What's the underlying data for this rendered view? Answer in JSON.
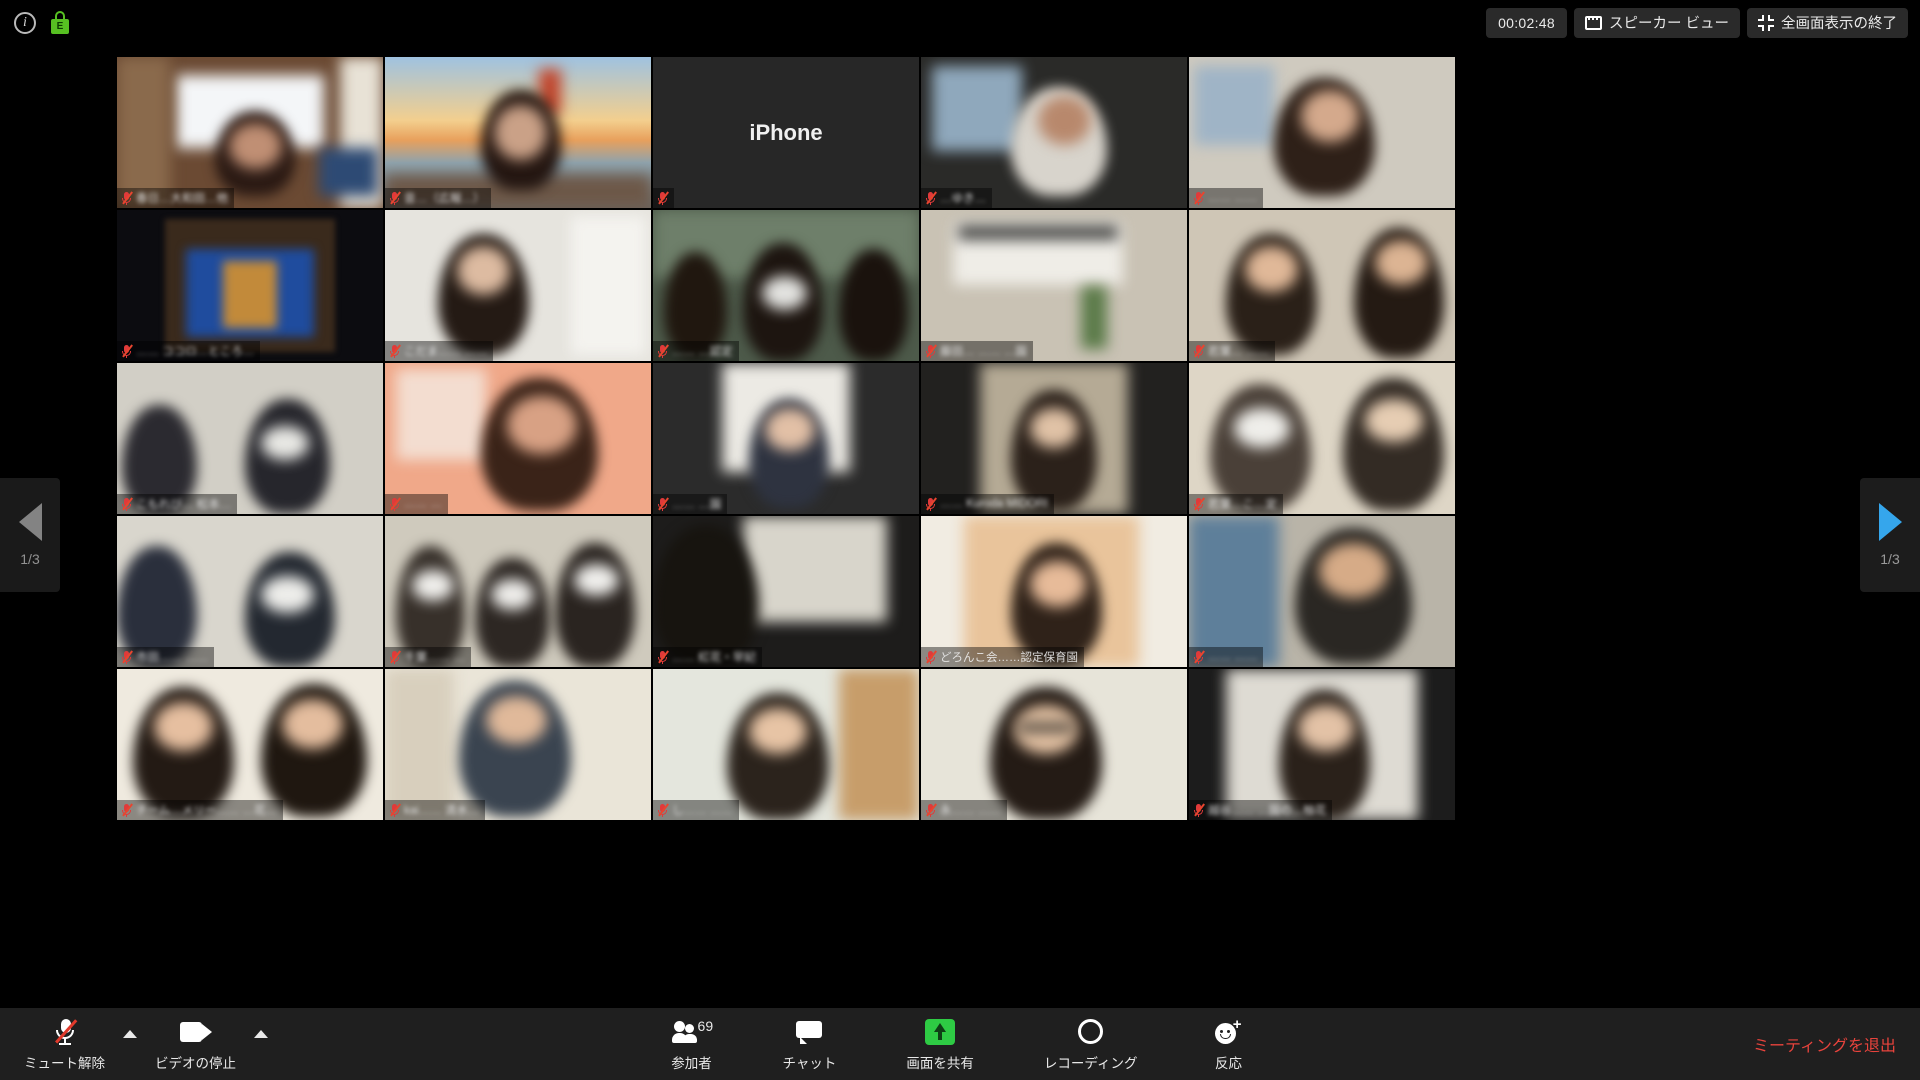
{
  "topbar": {
    "info_icon": "info-icon",
    "encryption_icon": "lock-icon",
    "encryption_letter": "E",
    "timer": "00:02:48",
    "speaker_view_label": "スピーカー ビュー",
    "exit_fullscreen_label": "全画面表示の終了"
  },
  "pagination": {
    "prev_label": "1/3",
    "next_label": "1/3",
    "prev_enabled": false,
    "next_enabled": true
  },
  "gallery": {
    "columns": 5,
    "rows": 5,
    "active_speaker_color": "#d9ec63",
    "tiles": [
      {
        "name": "春日…大和田…他",
        "muted": true,
        "blurred_name": true,
        "active": true,
        "kind": "video",
        "bg": "room-window",
        "placeholder": ""
      },
      {
        "name": "音…（広報…）",
        "muted": true,
        "blurred_name": true,
        "active": false,
        "kind": "video",
        "bg": "golden-gate",
        "placeholder": ""
      },
      {
        "name": "",
        "muted": true,
        "blurred_name": false,
        "active": false,
        "kind": "novideo",
        "bg": "dark",
        "placeholder": "iPhone"
      },
      {
        "name": "…ゆき…",
        "muted": true,
        "blurred_name": true,
        "active": false,
        "kind": "video",
        "bg": "room-dark",
        "placeholder": ""
      },
      {
        "name": "…… ……",
        "muted": true,
        "blurred_name": true,
        "active": false,
        "kind": "video",
        "bg": "room-blinds",
        "placeholder": ""
      },
      {
        "name": "…… ココロ…ところ…",
        "muted": true,
        "blurred_name": true,
        "active": false,
        "kind": "video",
        "bg": "notre-dame",
        "placeholder": ""
      },
      {
        "name": "こだま…… ……",
        "muted": true,
        "blurred_name": true,
        "active": false,
        "kind": "video",
        "bg": "room-white",
        "placeholder": ""
      },
      {
        "name": "…… …認定",
        "muted": true,
        "blurred_name": true,
        "active": false,
        "kind": "video",
        "bg": "room-group3",
        "placeholder": ""
      },
      {
        "name": "藤田… …… …園",
        "muted": true,
        "blurred_name": true,
        "active": false,
        "kind": "video",
        "bg": "room-shelf",
        "placeholder": ""
      },
      {
        "name": "若葉… ……",
        "muted": true,
        "blurred_name": true,
        "active": false,
        "kind": "video",
        "bg": "room-pair",
        "placeholder": ""
      },
      {
        "name": "こもれび… 松本…",
        "muted": true,
        "blurred_name": true,
        "active": false,
        "kind": "video",
        "bg": "room-gray-pair",
        "placeholder": ""
      },
      {
        "name": "…… …",
        "muted": true,
        "blurred_name": true,
        "active": false,
        "kind": "video",
        "bg": "room-warm",
        "placeholder": ""
      },
      {
        "name": "…… …園",
        "muted": true,
        "blurred_name": true,
        "active": false,
        "kind": "video",
        "bg": "room-stripe",
        "placeholder": ""
      },
      {
        "name": "…… Kuroda MIDORI",
        "muted": true,
        "blurred_name": true,
        "active": false,
        "kind": "video",
        "bg": "room-dim",
        "placeholder": ""
      },
      {
        "name": "若葉…こ…定",
        "muted": true,
        "blurred_name": true,
        "active": false,
        "kind": "video",
        "bg": "room-mask-pair",
        "placeholder": ""
      },
      {
        "name": "市田…… ……",
        "muted": true,
        "blurred_name": true,
        "active": false,
        "kind": "video",
        "bg": "room-dark-navy",
        "placeholder": ""
      },
      {
        "name": "千葉…… …",
        "muted": true,
        "blurred_name": true,
        "active": false,
        "kind": "video",
        "bg": "room-masks3",
        "placeholder": ""
      },
      {
        "name": "…… 紅花・早妃",
        "muted": true,
        "blurred_name": true,
        "active": false,
        "kind": "video",
        "bg": "room-dark-person",
        "placeholder": ""
      },
      {
        "name": "どろんこ会……認定保育園",
        "muted": true,
        "blurred_name": false,
        "active": false,
        "kind": "video",
        "bg": "room-beige",
        "placeholder": ""
      },
      {
        "name": "…… ……",
        "muted": true,
        "blurred_name": true,
        "active": false,
        "kind": "video",
        "bg": "room-office-man",
        "placeholder": ""
      },
      {
        "name": "チーム…メリー…… …花…",
        "muted": true,
        "blurred_name": true,
        "active": false,
        "kind": "video",
        "bg": "room-two-women",
        "placeholder": ""
      },
      {
        "name": "kai…… 清水…",
        "muted": true,
        "blurred_name": true,
        "active": false,
        "kind": "video",
        "bg": "room-denim",
        "placeholder": ""
      },
      {
        "name": "し…… ……",
        "muted": true,
        "blurred_name": true,
        "active": false,
        "kind": "video",
        "bg": "room-wood",
        "placeholder": ""
      },
      {
        "name": "永…… ……",
        "muted": true,
        "blurred_name": true,
        "active": false,
        "kind": "video",
        "bg": "room-glasses",
        "placeholder": ""
      },
      {
        "name": "越谷…… …園の…柚花",
        "muted": true,
        "blurred_name": true,
        "active": false,
        "kind": "video",
        "bg": "room-gray-woman",
        "placeholder": ""
      }
    ]
  },
  "toolbar": {
    "mute_label": "ミュート解除",
    "video_label": "ビデオの停止",
    "participants_label": "参加者",
    "participants_count": "69",
    "chat_label": "チャット",
    "share_label": "画面を共有",
    "record_label": "レコーディング",
    "reactions_label": "反応",
    "leave_label": "ミーティングを退出",
    "leave_color": "#e8433c",
    "share_color": "#2ecb44"
  }
}
